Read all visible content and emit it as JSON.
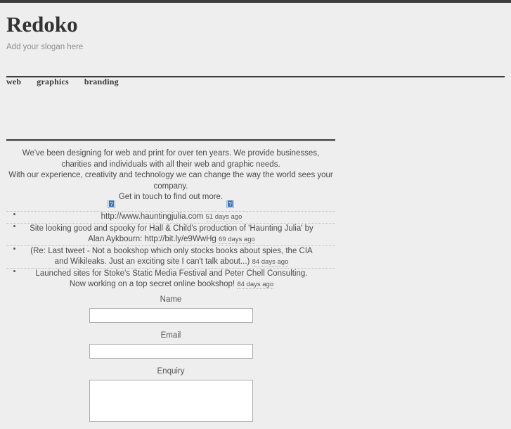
{
  "site": {
    "title": "Redoko",
    "slogan": "Add your slogan here"
  },
  "nav": {
    "items": [
      {
        "label": "web"
      },
      {
        "label": "graphics"
      },
      {
        "label": "branding"
      }
    ]
  },
  "intro": {
    "text": "We've been designing for web and print for over ten years. We provide businesses, charities and individuals with all their web and graphic needs. With our experience, creativity and technology we can change the way the world sees your company. Get in touch to find out more.",
    "line1": "We've been designing for web and print for over ten years. We provide businesses, charities and individuals with all their web and graphic needs.",
    "line2": "With our experience, creativity and technology we can change the way the world sees your company.",
    "line3": "Get in touch to find out more."
  },
  "twitter": {
    "broken_images": [
      {
        "icon": "broken-image-icon"
      },
      {
        "icon": "broken-image-icon"
      }
    ],
    "tweets": [
      {
        "text": "http://www.hauntingjulia.com",
        "link": "http://www.hauntingjulia.com",
        "ago": "51 days ago"
      },
      {
        "text": "Site looking good and spooky for Hall & Child's production of 'Haunting Julia' by Alan Aykbourn: http://bit.ly/e9WwHg",
        "link": "http://bit.ly/e9WwHg",
        "ago": "69 days ago"
      },
      {
        "text": "(Re: Last tweet - Not a bookshop which only stocks books about spies, the CIA and Wikileaks. Just an exciting site I can't talk about...)",
        "link": "",
        "ago": "84 days ago"
      },
      {
        "text": "Launched sites for Stoke's Static Media Festival and Peter Chell Consulting. Now working on a top secret online bookshop!",
        "link": "",
        "ago": "84 days ago"
      }
    ]
  },
  "form": {
    "fields": [
      {
        "label": "Name",
        "value": "",
        "placeholder": ""
      },
      {
        "label": "Email",
        "value": "",
        "placeholder": ""
      },
      {
        "label": "Enquiry",
        "value": "",
        "placeholder": ""
      }
    ]
  },
  "colors": {
    "background": "#eeeeee",
    "rule": "#3c3c3c",
    "text": "#4a4a4a",
    "slogan": "#8e8e8e",
    "broken_image_accent": "#3b74b4"
  }
}
